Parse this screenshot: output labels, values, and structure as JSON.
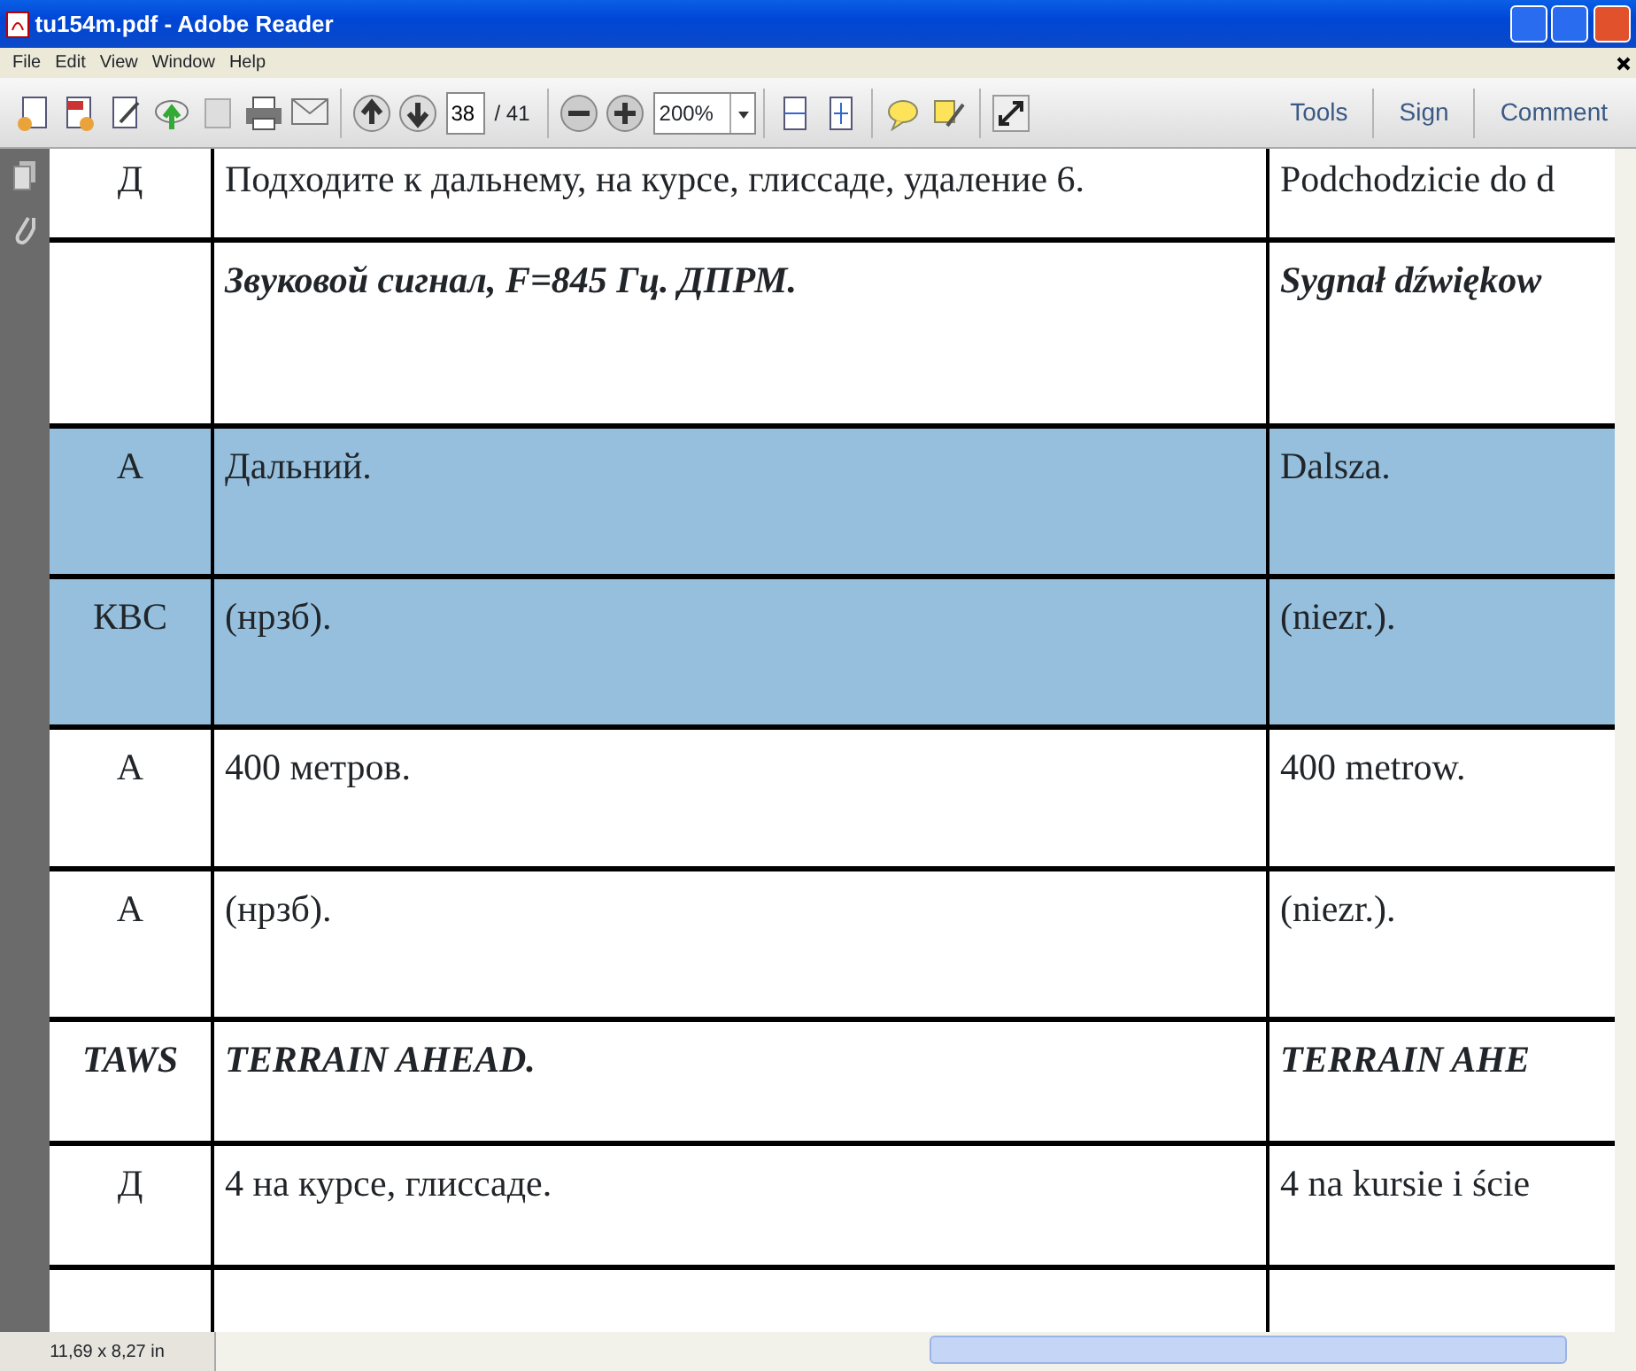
{
  "window": {
    "title": "tu154m.pdf - Adobe Reader"
  },
  "menu": [
    "File",
    "Edit",
    "View",
    "Window",
    "Help"
  ],
  "toolbar": {
    "page_number": "38",
    "page_count": "/ 41",
    "zoom": "200%",
    "links": [
      "Tools",
      "Sign",
      "Comment"
    ]
  },
  "document": {
    "rows": [
      {
        "kind": "normal",
        "selected": false,
        "cells": [
          "Д",
          "Подходите к дальнему, на курсе, глиссаде, удаление 6.",
          "Podchodzicie do d"
        ]
      },
      {
        "kind": "heading",
        "selected": false,
        "cells": [
          "",
          "Звуковой сигнал, F=845 Гц. ДПРМ.",
          "Sygnał dźwiękow"
        ]
      },
      {
        "kind": "normal",
        "selected": true,
        "cells": [
          "А",
          "Дальний.",
          "Dalsza."
        ]
      },
      {
        "kind": "normal",
        "selected": true,
        "cells": [
          "КВС",
          "(нрзб).",
          "(niezr.)."
        ]
      },
      {
        "kind": "normal",
        "selected": false,
        "cells": [
          "А",
          "400 метров.",
          "400 metrow."
        ]
      },
      {
        "kind": "normal",
        "selected": false,
        "cells": [
          "А",
          "(нрзб).",
          "(niezr.)."
        ]
      },
      {
        "kind": "heading",
        "selected": false,
        "cells": [
          "TAWS",
          "TERRAIN AHEAD.",
          "TERRAIN AHE"
        ]
      },
      {
        "kind": "normal",
        "selected": false,
        "cells": [
          "Д",
          "4 на курсе, глиссаде.",
          "4 na kursie i ście"
        ]
      }
    ]
  },
  "status_bar": {
    "page_size": "11,69 x 8,27 in"
  }
}
